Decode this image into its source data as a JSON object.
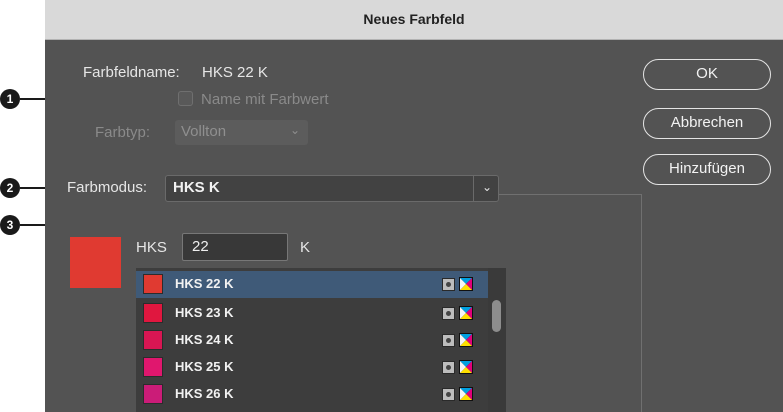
{
  "window": {
    "title": "Neues Farbfeld"
  },
  "form": {
    "swatch_name_label": "Farbfeldname:",
    "swatch_name_value": "HKS 22 K",
    "name_with_value_label": "Name mit Farbwert",
    "name_with_value_checked": false,
    "color_type_label": "Farbtyp:",
    "color_type_value": "Vollton",
    "color_mode_label": "Farbmodus:",
    "color_mode_value": "HKS K",
    "hks_prefix": "HKS",
    "hks_input_value": "22",
    "hks_suffix": "K",
    "preview_color": "#e03a31"
  },
  "swatch_list": [
    {
      "name": "HKS 22 K",
      "color": "#e03a31",
      "selected": true
    },
    {
      "name": "HKS 23 K",
      "color": "#e0173f",
      "selected": false
    },
    {
      "name": "HKS 24 K",
      "color": "#d81653",
      "selected": false
    },
    {
      "name": "HKS 25 K",
      "color": "#e0176e",
      "selected": false
    },
    {
      "name": "HKS 26 K",
      "color": "#cb1c78",
      "selected": false
    }
  ],
  "buttons": {
    "ok": "OK",
    "cancel": "Abbrechen",
    "add": "Hinzufügen"
  },
  "callouts": [
    "1",
    "2",
    "3"
  ],
  "icons": {
    "spot_color_icon": "spot-color-icon",
    "cmyk_icon": "cmyk-process-icon",
    "chevron": "chevron-down-icon"
  }
}
